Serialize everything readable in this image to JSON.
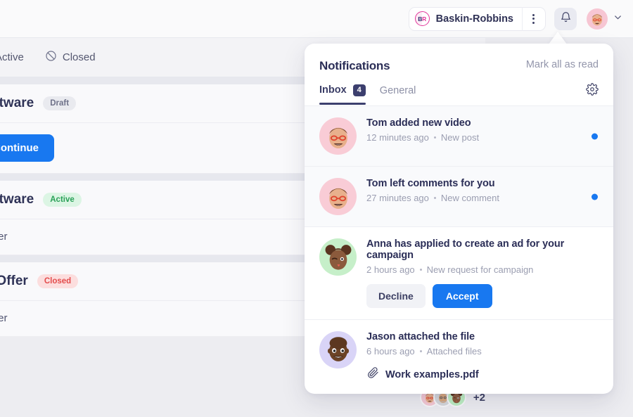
{
  "topbar": {
    "org_name": "Baskin-Robbins",
    "org_logo_text": "BR",
    "kebab_icon": "more-vertical-icon",
    "bell_icon": "bell-icon",
    "chevron_icon": "chevron-down-icon"
  },
  "background": {
    "filters": [
      {
        "label": "Active",
        "icon": "star-icon"
      },
      {
        "label": "Closed",
        "icon": "ban-icon"
      }
    ],
    "cards": [
      {
        "title": "Software",
        "badge": "Draft",
        "badge_kind": "draft",
        "action": "Continue"
      },
      {
        "title": "Software",
        "badge": "Active",
        "badge_kind": "active",
        "member": "ember"
      },
      {
        "title": "ve Offer",
        "badge": "Closed",
        "badge_kind": "closed",
        "member": "ember"
      }
    ],
    "avatar_overflow": "+2"
  },
  "notifications": {
    "title": "Notifications",
    "mark_all_label": "Mark all as read",
    "settings_icon": "gear-icon",
    "tabs": [
      {
        "label": "Inbox",
        "count": "4",
        "active": true
      },
      {
        "label": "General",
        "count": "",
        "active": false
      }
    ],
    "items": [
      {
        "title": "Tom added new video",
        "time": "12 minutes ago",
        "category": "New post",
        "unread": true,
        "avatar": "tom",
        "avatar_bg": "#f9ccd6"
      },
      {
        "title": "Tom left comments for you",
        "time": "27 minutes ago",
        "category": "New comment",
        "unread": true,
        "avatar": "tom",
        "avatar_bg": "#f9ccd6"
      },
      {
        "title": "Anna has applied to create an ad for your campaign",
        "time": "2 hours ago",
        "category": "New request for campaign",
        "unread": false,
        "avatar": "anna",
        "avatar_bg": "#c6efc9",
        "decline_label": "Decline",
        "accept_label": "Accept"
      },
      {
        "title": "Jason attached the file",
        "time": "6 hours ago",
        "category": "Attached files",
        "unread": false,
        "avatar": "jason",
        "avatar_bg": "#d9d4f7",
        "file_name": "Work examples.pdf",
        "file_icon": "paperclip-icon"
      }
    ]
  },
  "colors": {
    "accent_blue": "#1878f0",
    "ink": "#2b2e57",
    "muted": "#9b9eb1",
    "badge_navy": "#3c3f6e",
    "active_green": "#2aa158",
    "closed_red": "#e34c4c"
  }
}
